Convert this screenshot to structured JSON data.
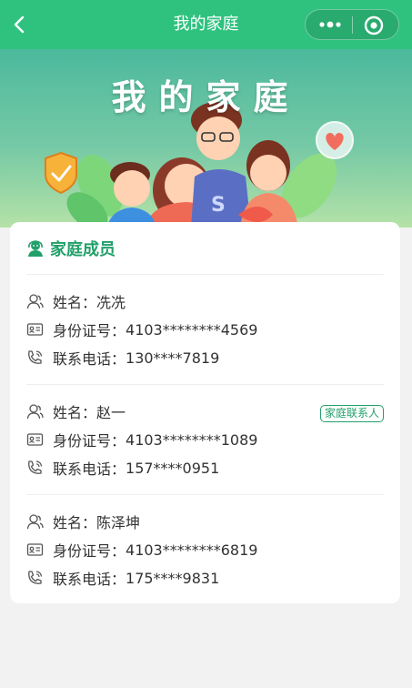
{
  "nav": {
    "title": "我的家庭"
  },
  "banner": {
    "title": "我的家庭"
  },
  "section": {
    "title": "家庭成员"
  },
  "members": [
    {
      "name_label": "姓名：",
      "name": "冼冼",
      "id_label": "身份证号：",
      "id": "4103********4569",
      "phone_label": "联系电话：",
      "phone": "130****7819"
    },
    {
      "name_label": "姓名：",
      "name": "赵一",
      "id_label": "身份证号：",
      "id": "4103********1089",
      "phone_label": "联系电话：",
      "phone": "157****0951",
      "badge": "家庭联系人"
    },
    {
      "name_label": "姓名：",
      "name": "陈泽坤",
      "id_label": "身份证号：",
      "id": "4103********6819",
      "phone_label": "联系电话：",
      "phone": "175****9831"
    }
  ],
  "colors": {
    "nav": "#2fc27f",
    "accent": "#21a06a",
    "page_bg": "#f2f2f2"
  },
  "icons": [
    "back-arrow-icon",
    "more-dots-icon",
    "close-target-icon",
    "family-icon",
    "person-icon",
    "id-card-icon",
    "phone-icon"
  ]
}
